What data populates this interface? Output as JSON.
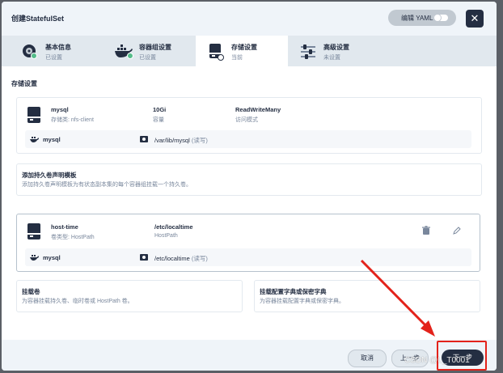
{
  "header": {
    "title": "创建StatefulSet",
    "yaml_label": "编辑 YAML",
    "close_symbol": "✕"
  },
  "steps": [
    {
      "name": "基本信息",
      "status": "已设置"
    },
    {
      "name": "容器组设置",
      "status": "已设置"
    },
    {
      "name": "存储设置",
      "status": "当前"
    },
    {
      "name": "高级设置",
      "status": "未设置"
    }
  ],
  "section_title": "存储设置",
  "volume1": {
    "name": "mysql",
    "storage_class": "存储类: nfs-client",
    "size": "10Gi",
    "size_label": "容量",
    "access_mode": "ReadWriteMany",
    "access_label": "访问模式",
    "mount": {
      "container": "mysql",
      "path": "/var/lib/mysql",
      "mode": "(读写)"
    }
  },
  "add_template": {
    "title": "添加持久卷声明模板",
    "desc": "添加持久卷声明模板为有状态副本集的每个容器组挂载一个持久卷。"
  },
  "volume2": {
    "name": "host-time",
    "type": "卷类型: HostPath",
    "path": "/etc/localtime",
    "path_label": "HostPath",
    "mount": {
      "container": "mysql",
      "path": "/etc/localtime",
      "mode": "(读写)"
    }
  },
  "mount_volume": {
    "title": "挂载卷",
    "desc": "为容器挂载持久卷、临时卷或 HostPath 卷。"
  },
  "mount_config": {
    "title": "挂载配置字典或保密字典",
    "desc": "为容器挂载配置字典或保密字典。"
  },
  "footer": {
    "cancel": "取消",
    "prev": "上一步",
    "next": "下一步"
  },
  "watermark": "CSDN @L_T0001",
  "colors": {
    "primary": "#242e42",
    "success": "#55bc8a",
    "highlight": "#e3231b"
  }
}
